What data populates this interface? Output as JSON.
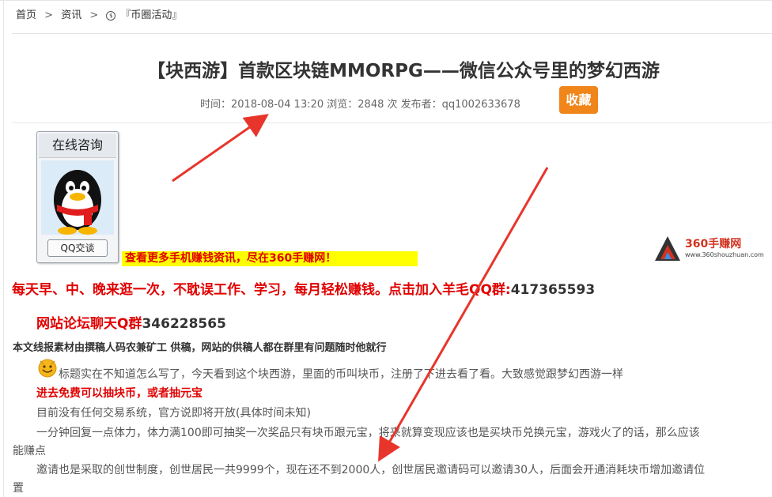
{
  "breadcrumb": {
    "home": "首页",
    "sep1": ">",
    "news": "资讯",
    "sep2": ">",
    "category": "『币圈活动』"
  },
  "article": {
    "title": "【块西游】首款区块链MMORPG——微信公众号里的梦幻西游",
    "meta": "时间：2018-08-04 13:20 浏览：2848 次 发布者：qq1002633678",
    "favorite_label": "收藏"
  },
  "qq_widget": {
    "header": "在线咨询",
    "button": "QQ交谈",
    "icon": "qq-penguin-icon"
  },
  "promo_banner": "查看更多手机赚钱资讯，尽在360手赚网！",
  "logo": {
    "name": "360手赚网",
    "url": "www.360shouzhuan.com",
    "icon": "360-triangle-logo-icon"
  },
  "content": {
    "group_line": "每天早、中、晚来逛一次，不耽误工作、学习，每月轻松赚钱。点击加入羊毛QQ群:",
    "group_number": "417365593",
    "forum_line": "网站论坛聊天Q群",
    "forum_number": "346228565",
    "source_line": "本文线报素材由撰稿人码农兼矿工 供稿，网站的供稿人都在群里有问题随时他就行",
    "p1": "标题实在不知道怎么写了，今天看到这个块西游，里面的币叫块币，注册了下进去看了看。大致感觉跟梦幻西游一样",
    "red_sub": "进去免费可以抽块币，或者抽元宝",
    "p2": "目前没有任何交易系统，官方说即将开放(具体时间未知)",
    "p3a": "一分钟回复一点体力，体力满100即可抽奖一次奖品只有块币跟元宝，将来就算变现应该也是买块币兑换元宝，游戏火了的话，那么应该",
    "p3b": "能赚点",
    "p4a": "邀请也是采取的创世制度，创世居民一共9999个，现在还不到2000人，创世居民邀请码可以邀请30人，后面会开通消耗块币增加邀请位",
    "p4b": "置"
  },
  "colors": {
    "accent_red": "#e00000",
    "favorite_orange": "#f08519",
    "banner_yellow": "#ffff00",
    "arrow_red": "#e8352b"
  }
}
